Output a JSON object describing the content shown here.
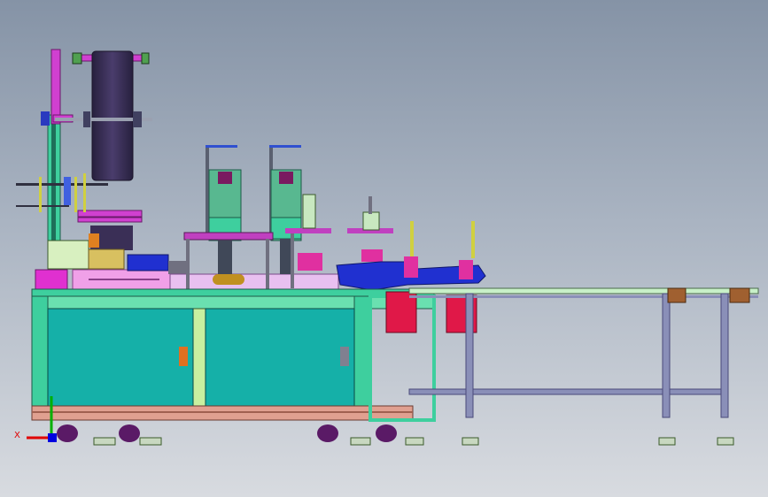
{
  "viewport": {
    "background_top": "#8593a6",
    "background_bottom": "#d8dbe0"
  },
  "machine": {
    "frame_color": "#3ecf9e",
    "panel_color": "#15b0a8",
    "accent_pink": "#e048d8",
    "accent_blue": "#2030d0",
    "accent_red": "#e01848",
    "reel_color": "#3a2f56",
    "rail_color": "#8a8fb8",
    "caster_color": "#5a1a66"
  },
  "triad": {
    "x_label": "X",
    "x_color": "#e00000",
    "y_color": "#00b000",
    "z_color": "#0000e0"
  }
}
